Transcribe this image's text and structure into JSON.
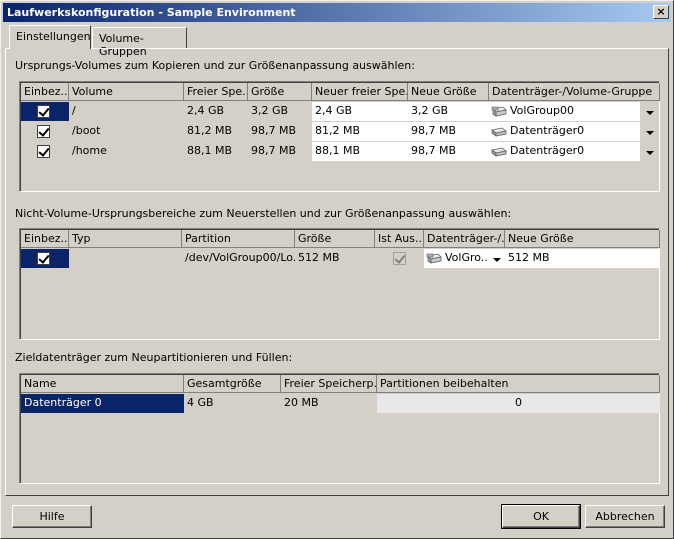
{
  "window": {
    "title": "Laufwerkskonfiguration - Sample Environment",
    "close_glyph": "×"
  },
  "tabs": [
    {
      "label": "Einstellungen"
    },
    {
      "label": "Volume-Gruppen"
    }
  ],
  "section1": {
    "label": "Ursprungs-Volumes zum Kopieren und zur Größenanpassung auswählen:",
    "columns": [
      "Einbez...",
      "Volume",
      "Freier Spe...",
      "Größe",
      "Neuer freier Spe...",
      "Neue Größe",
      "Datenträger-/Volume-Gruppe"
    ],
    "rows": [
      {
        "checked": true,
        "volume": "/",
        "free": "2,4 GB",
        "size": "3,2 GB",
        "new_free": "2,4 GB",
        "new_size": "3,2 GB",
        "target": "VolGroup00",
        "icon": "volume-group-icon"
      },
      {
        "checked": true,
        "volume": "/boot",
        "free": "81,2 MB",
        "size": "98,7 MB",
        "new_free": "81,2 MB",
        "new_size": "98,7 MB",
        "target": "Datenträger0",
        "icon": "disk-icon"
      },
      {
        "checked": true,
        "volume": "/home",
        "free": "88,1 MB",
        "size": "98,7 MB",
        "new_free": "88,1 MB",
        "new_size": "98,7 MB",
        "target": "Datenträger0",
        "icon": "disk-icon"
      }
    ]
  },
  "section2": {
    "label": "Nicht-Volume-Ursprungsbereiche zum Neuerstellen und zur Größenanpassung auswählen:",
    "columns": [
      "Einbez...",
      "Typ",
      "Partition",
      "Größe",
      "Ist Aus...",
      "Datenträger-/...",
      "Neue Größe"
    ],
    "rows": [
      {
        "checked": true,
        "type": "",
        "partition": "/dev/VolGroup00/Lo...",
        "size": "512 MB",
        "is_active": true,
        "target": "VolGro...",
        "new_size": "512 MB"
      }
    ]
  },
  "section3": {
    "label": "Zieldatenträger zum Neupartitionieren und Füllen:",
    "columns": [
      "Name",
      "Gesamtgröße",
      "Freier Speicherp...",
      "Partitionen beibehalten"
    ],
    "rows": [
      {
        "name": "Datenträger 0",
        "total": "4 GB",
        "free": "20 MB",
        "keep": "0"
      }
    ]
  },
  "buttons": {
    "help": "Hilfe",
    "ok": "OK",
    "cancel": "Abbrechen"
  }
}
